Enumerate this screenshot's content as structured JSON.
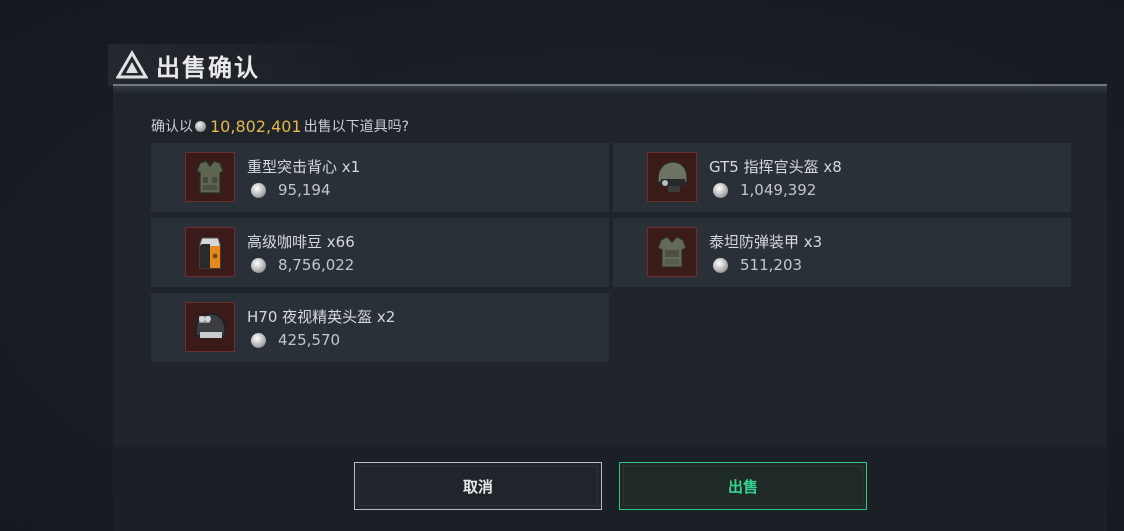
{
  "dialog": {
    "title": "出售确认",
    "confirm": {
      "prefix": "确认以",
      "amount": "10,802,401",
      "suffix": "出售以下道具吗?"
    },
    "items": [
      {
        "name": "重型突击背心 x1",
        "price": "95,194",
        "icon": "vest-icon"
      },
      {
        "name": "GT5 指挥官头盔 x8",
        "price": "1,049,392",
        "icon": "helmet-icon"
      },
      {
        "name": "高级咖啡豆 x66",
        "price": "8,756,022",
        "icon": "coffee-bag-icon"
      },
      {
        "name": "泰坦防弹装甲 x3",
        "price": "511,203",
        "icon": "armor-icon"
      },
      {
        "name": "H70 夜视精英头盔 x2",
        "price": "425,570",
        "icon": "night-vision-helmet-icon"
      }
    ],
    "buttons": {
      "cancel": "取消",
      "sell": "出售"
    }
  },
  "colors": {
    "accent_green": "#35d391",
    "price_gold": "#e2b84a",
    "thumb_bg": "#3b1a1a"
  }
}
